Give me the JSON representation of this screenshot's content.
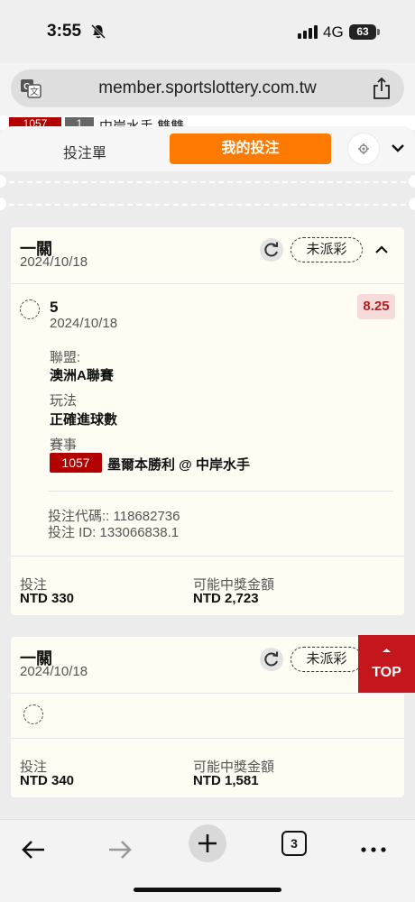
{
  "status_bar": {
    "time": "3:55",
    "network": "4G",
    "battery": "63"
  },
  "browser": {
    "url": "member.sportslottery.com.tw",
    "tab_count": "3"
  },
  "peek_row": {
    "event_no": "1057",
    "tag": "1",
    "text": "中岸水手 雙雙"
  },
  "tabs": {
    "betslip": "投注單",
    "my_bets": "我的投注"
  },
  "bets": [
    {
      "type": "一關",
      "date": "2024/10/18",
      "status": "未派彩",
      "selection": "5",
      "selection_date": "2024/10/18",
      "odds": "8.25",
      "league_label": "聯盟:",
      "league": "澳洲A聯賽",
      "market_label": "玩法",
      "market": "正確進球數",
      "event_label": "賽事",
      "event_no": "1057",
      "event_name": "墨爾本勝利 @ 中岸水手",
      "bet_code": "投注代碼:: 118682736",
      "bet_id": "投注 ID: 133066838.1",
      "stake_label": "投注",
      "stake": "NTD 330",
      "payout_label": "可能中獎金額",
      "payout": "NTD 2,723"
    },
    {
      "type": "一關",
      "date": "2024/10/18",
      "status": "未派彩",
      "stake_label": "投注",
      "stake": "NTD 340",
      "payout_label": "可能中獎金額",
      "payout": "NTD 1,581"
    }
  ],
  "top_button": "TOP",
  "colors": {
    "accent": "#ff7a00",
    "event_badge": "#b30000",
    "odds": "#b22020",
    "top": "#c4161c"
  }
}
